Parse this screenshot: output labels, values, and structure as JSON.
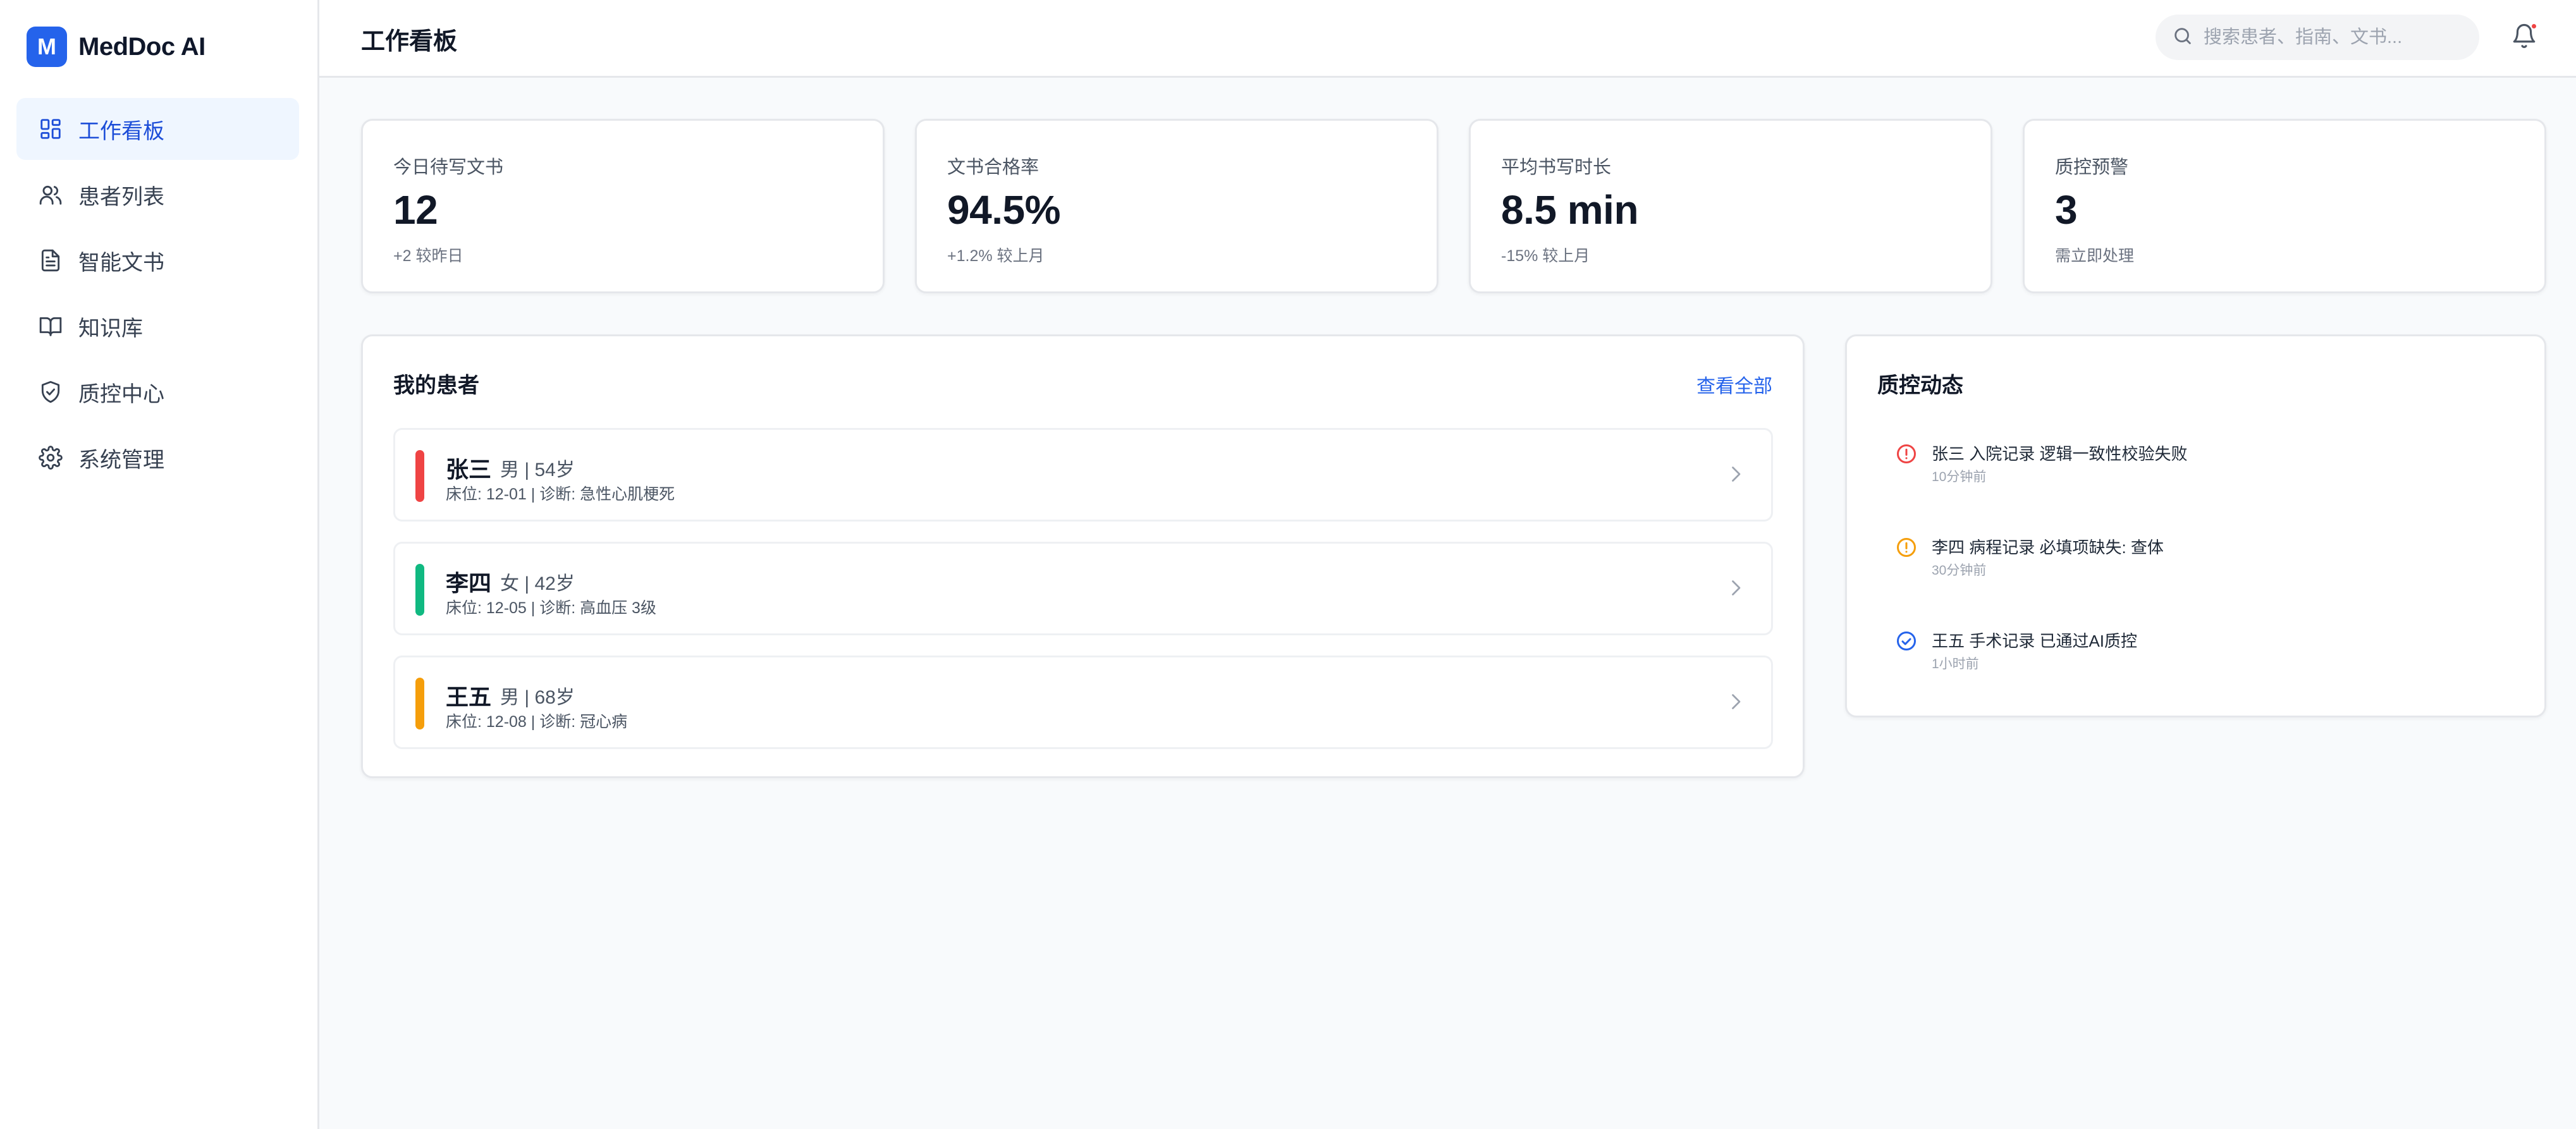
{
  "brand": {
    "logo_letter": "M",
    "name": "MedDoc AI"
  },
  "sidebar": {
    "items": [
      {
        "label": "工作看板",
        "icon": "dashboard-icon",
        "active": true
      },
      {
        "label": "患者列表",
        "icon": "users-icon",
        "active": false
      },
      {
        "label": "智能文书",
        "icon": "document-icon",
        "active": false
      },
      {
        "label": "知识库",
        "icon": "book-icon",
        "active": false
      },
      {
        "label": "质控中心",
        "icon": "shield-check-icon",
        "active": false
      },
      {
        "label": "系统管理",
        "icon": "gear-icon",
        "active": false
      }
    ]
  },
  "header": {
    "title": "工作看板",
    "search_placeholder": "搜索患者、指南、文书...",
    "search_icon": "search-icon",
    "bell_icon": "bell-icon"
  },
  "stats": [
    {
      "label": "今日待写文书",
      "value": "12",
      "sub": "+2 较昨日"
    },
    {
      "label": "文书合格率",
      "value": "94.5%",
      "sub": "+1.2% 较上月"
    },
    {
      "label": "平均书写时长",
      "value": "8.5 min",
      "sub": "-15% 较上月"
    },
    {
      "label": "质控预警",
      "value": "3",
      "sub": "需立即处理"
    }
  ],
  "patients_panel": {
    "title": "我的患者",
    "view_all": "查看全部",
    "patients": [
      {
        "name": "张三",
        "meta": "男 | 54岁",
        "detail": "床位: 12-01 | 诊断: 急性心肌梗死",
        "status_color": "#ef4444"
      },
      {
        "name": "李四",
        "meta": "女 | 42岁",
        "detail": "床位: 12-05 | 诊断: 高血压 3级",
        "status_color": "#10b981"
      },
      {
        "name": "王五",
        "meta": "男 | 68岁",
        "detail": "床位: 12-08 | 诊断: 冠心病",
        "status_color": "#f59e0b"
      }
    ]
  },
  "qc_panel": {
    "title": "质控动态",
    "events": [
      {
        "text": "张三 入院记录 逻辑一致性校验失败",
        "time": "10分钟前",
        "icon": "alert-circle-icon",
        "color": "#ef4444"
      },
      {
        "text": "李四 病程记录 必填项缺失: 查体",
        "time": "30分钟前",
        "icon": "warning-circle-icon",
        "color": "#f59e0b"
      },
      {
        "text": "王五 手术记录 已通过AI质控",
        "time": "1小时前",
        "icon": "check-circle-icon",
        "color": "#2563eb"
      }
    ]
  },
  "colors": {
    "accent": "#2563eb",
    "active_bg": "#eff6ff"
  }
}
